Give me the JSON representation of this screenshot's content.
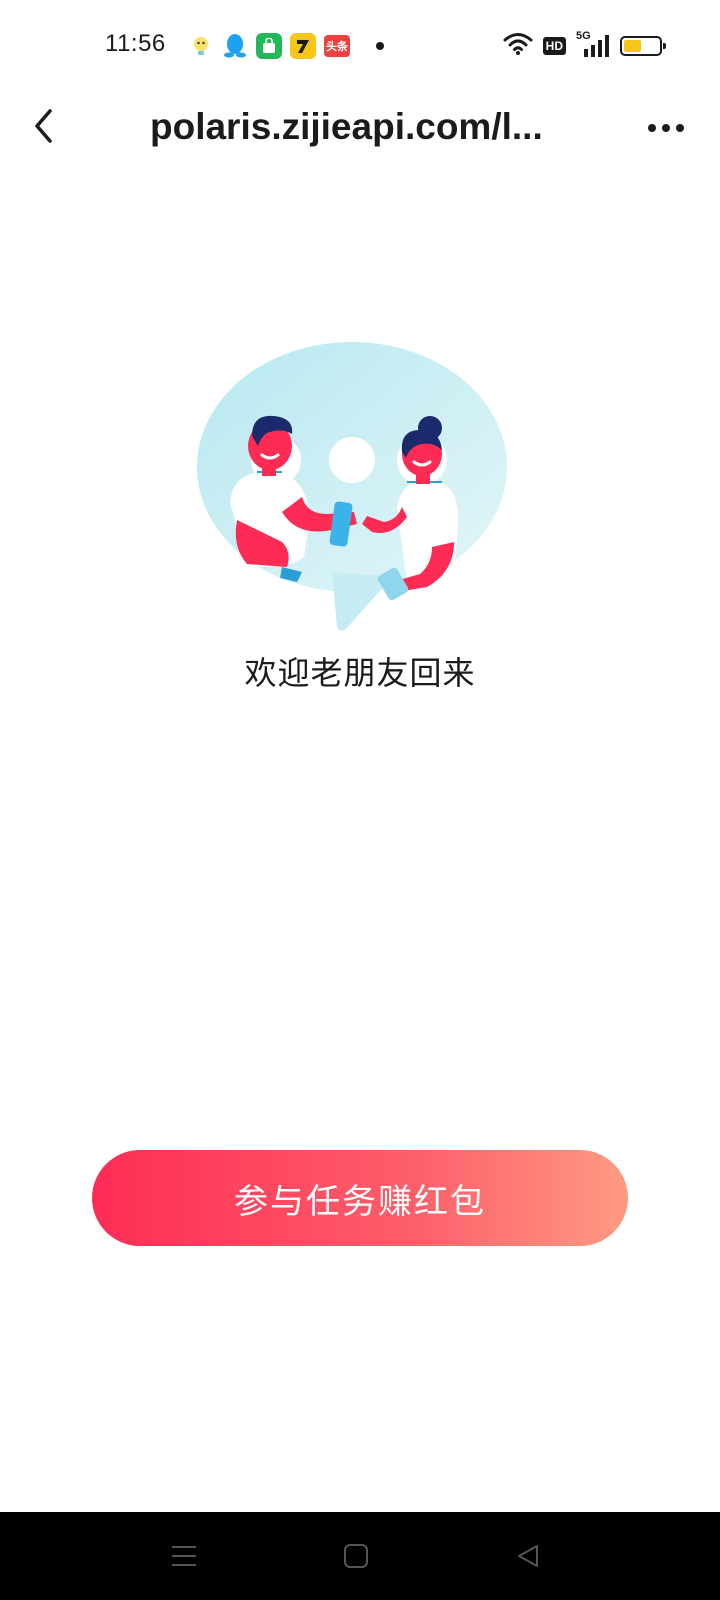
{
  "status_bar": {
    "time": "11:56",
    "network_label": "5G",
    "hd_label": "HD",
    "battery_level": 0.55,
    "notification_icons": [
      "lightbulb-app-icon",
      "qq-icon",
      "shopping-bag-app-icon",
      "game-app-icon",
      "toutiao-icon"
    ],
    "toutiao_label": "头条"
  },
  "header": {
    "title": "polaris.zijieapi.com/l..."
  },
  "main": {
    "welcome_text": "欢迎老朋友回来",
    "cta_label": "参与任务赚红包"
  },
  "nav_bar": {
    "items": [
      "menu-icon",
      "home-icon",
      "back-icon"
    ]
  },
  "colors": {
    "cta_gradient_start": "#fe2c55",
    "cta_gradient_end": "#fe9a83",
    "bubble": "#c9eef4",
    "figure_skin": "#fe2c55",
    "hair": "#1b2a6b"
  }
}
